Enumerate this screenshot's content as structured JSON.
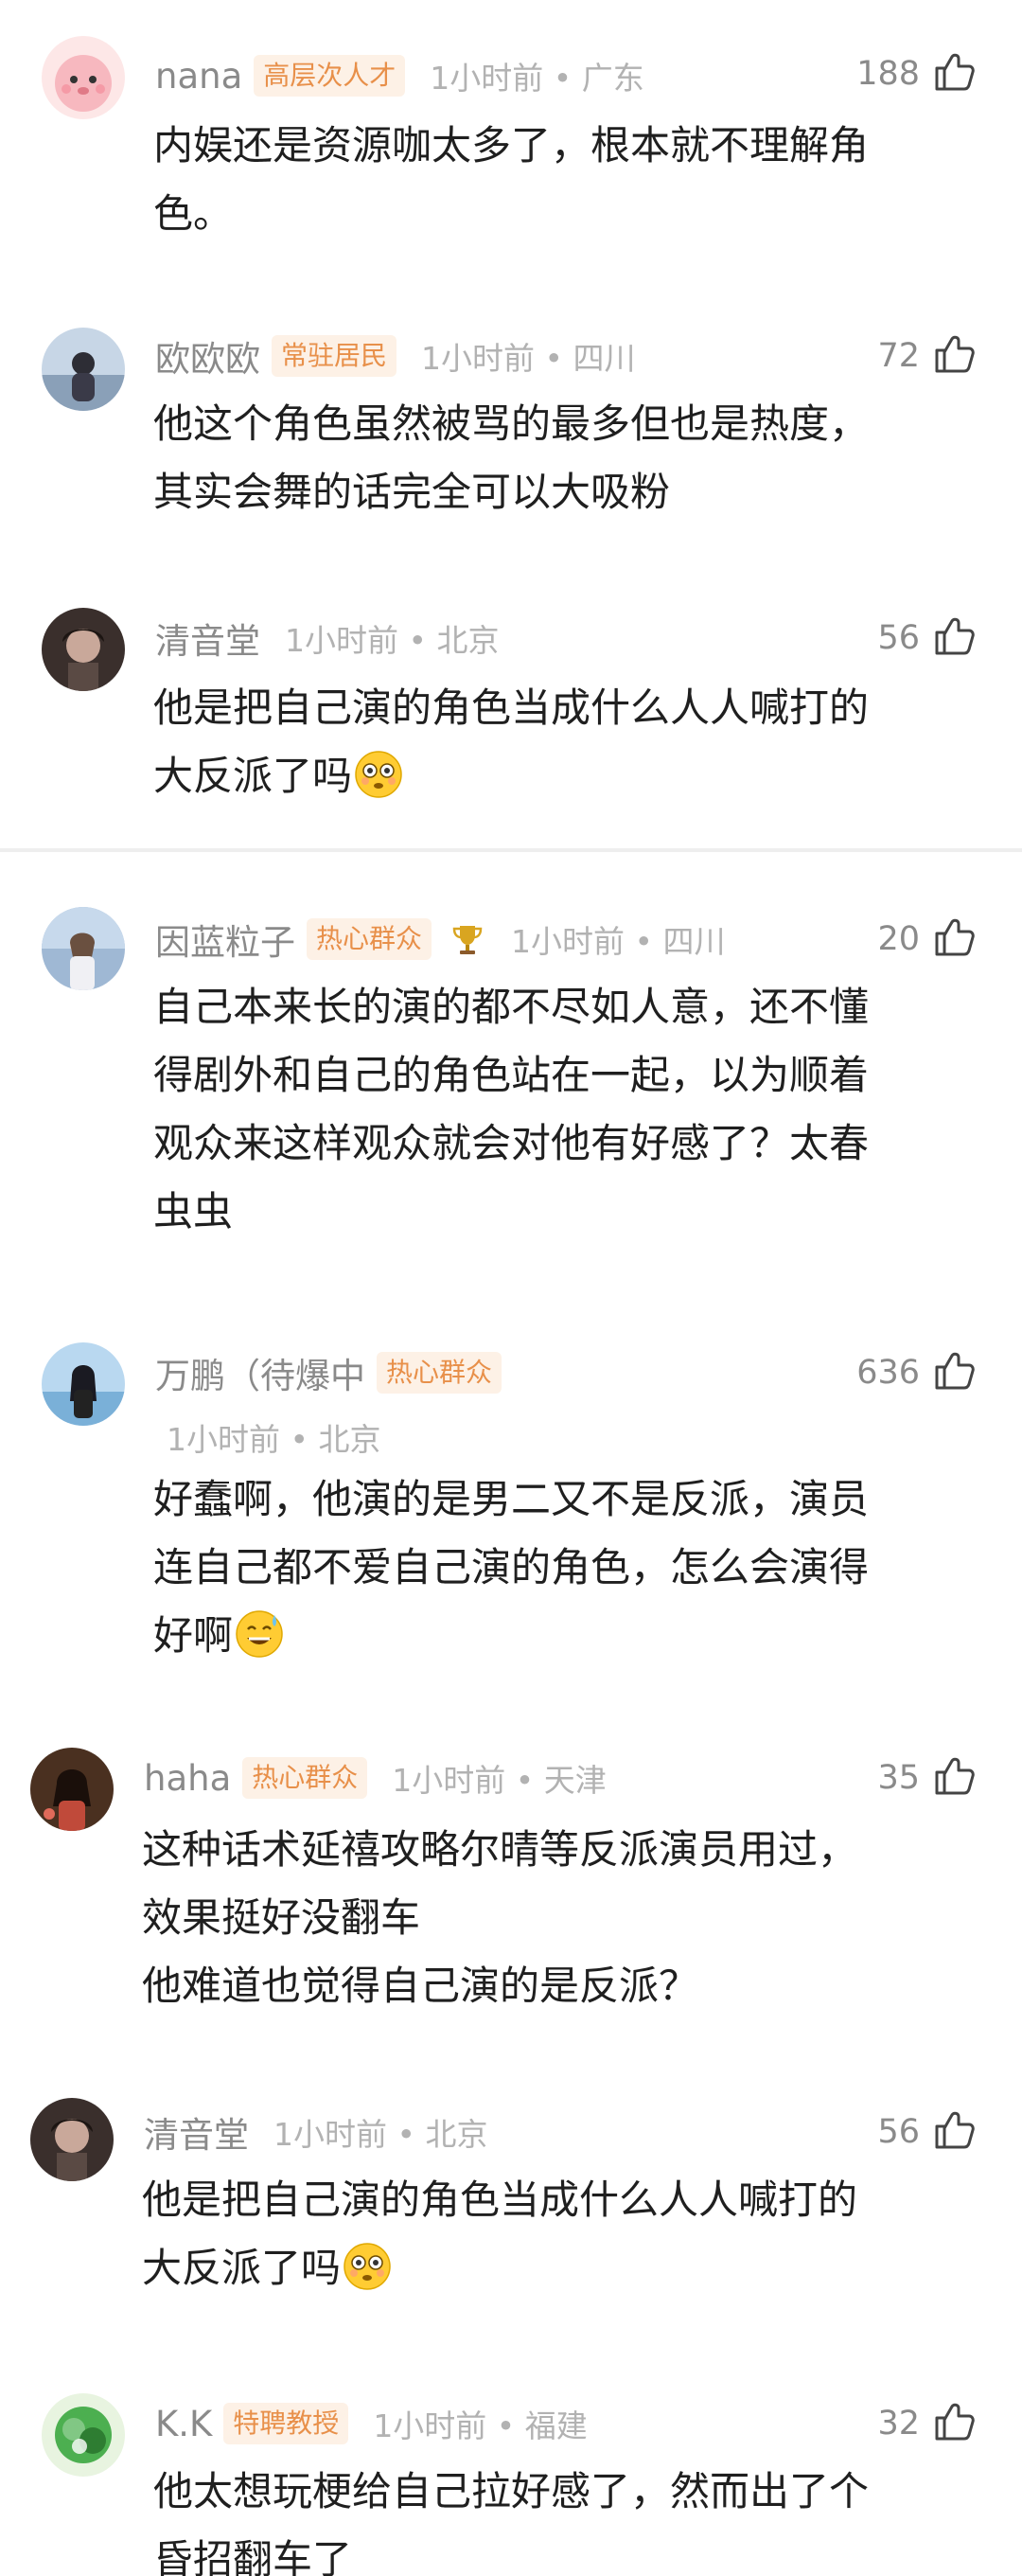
{
  "comments": [
    {
      "username": "nana",
      "badge": "高层次人才",
      "time": "1小时前 • 广东",
      "likes": "188",
      "text": "内娱还是资源咖太多了，根本就不理解角\n色。"
    },
    {
      "username": "欧欧欧",
      "badge": "常驻居民",
      "time": "1小时前 • 四川",
      "likes": "72",
      "text": "他这个角色虽然被骂的最多但也是热度，\n其实会舞的话完全可以大吸粉"
    },
    {
      "username": "清音堂",
      "time": "1小时前 • 北京",
      "likes": "56",
      "text": "他是把自己演的角色当成什么人人喊打的\n大反派了吗"
    },
    {
      "username": "因蓝粒子",
      "badge": "热心群众",
      "time": "1小时前 • 四川",
      "likes": "20",
      "text": "自己本来长的演的都不尽如人意，还不懂\n得剧外和自己的角色站在一起，以为顺着\n观众来这样观众就会对他有好感了？太春\n虫虫"
    },
    {
      "username": "万鹏（待爆中",
      "badge": "热心群众",
      "time": "1小时前 • 北京",
      "likes": "636",
      "text": "好蠢啊，他演的是男二又不是反派，演员\n连自己都不爱自己演的角色，怎么会演得\n好啊"
    },
    {
      "username": "haha",
      "badge": "热心群众",
      "time": "1小时前 • 天津",
      "likes": "35",
      "text": "这种话术延禧攻略尔晴等反派演员用过，\n效果挺好没翻车\n他难道也觉得自己演的是反派？"
    },
    {
      "username": "清音堂",
      "time": "1小时前 • 北京",
      "likes": "56",
      "text": "他是把自己演的角色当成什么人人喊打的\n大反派了吗"
    },
    {
      "username": "K.K",
      "badge": "特聘教授",
      "time": "1小时前 • 福建",
      "likes": "32",
      "text": "他太想玩梗给自己拉好感了，然而出了个\n昏招翻车了"
    }
  ],
  "colors": {
    "badge_text": "#e8904a",
    "badge_bg": "#fdf1e6",
    "meta_gray": "#8a8a8a",
    "time_gray": "#b2b2b2"
  },
  "icons": {
    "like": "thumbs-up-outline-icon",
    "trophy": "trophy-icon",
    "emoji_flushed": "flushed-face-emoji",
    "emoji_sweat": "grinning-sweat-emoji"
  }
}
